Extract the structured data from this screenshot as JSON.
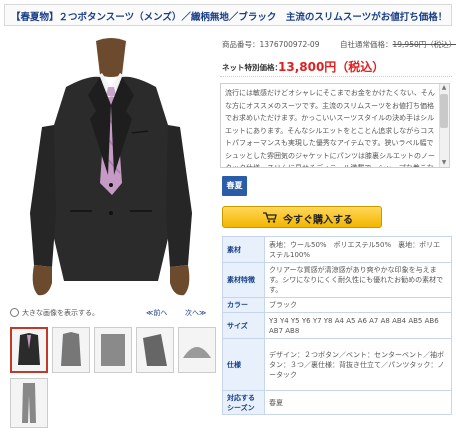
{
  "title": "【春夏物】２つボタンスーツ（メンズ）／織柄無地／ブラック　主流のスリムスーツがお値打ち価格！",
  "product": {
    "code_label": "商品番号：",
    "code": "1376700972-09",
    "list_price_label": "自社通常価格：",
    "list_price": "19,950円（税込）",
    "net_label": "ネット特別価格：",
    "net_price": "13,800円（税込）"
  },
  "description": "流行には敏感だけどオシャレにそこまでお金をかけたくない、そんな方にオススメのスーツです。主流のスリムスーツをお値打ち価格でお求めいただけます。かっこいいスーツスタイルの決め手はシルエットにあります。そんなシルエットをとことん追求しながらコストパフォーマンスも実現した優秀なアイテムです。狭いラペル幅でシュッとした雰囲気のジャケットにパンツは膝裏シルエットのノータック仕様。スリムに見せるディテール満載で、シャープな着こなしが楽しめます。",
  "season_badge": "春夏",
  "buy_button": "今すぐ購入する",
  "zoom": {
    "label": "大きな画像を表示する。",
    "prev": "≪前へ",
    "next": "次へ≫"
  },
  "specs": [
    {
      "label": "素材",
      "value": "表地：ウール50%　ポリエステル50%　裏地：ポリエステル100%"
    },
    {
      "label": "素材特徴",
      "value": "クリアーな質感が清涼感があり爽やかな印象を与えます。シワになりにくく耐久性にも優れたお勧めの素材です。"
    },
    {
      "label": "カラー",
      "value": "ブラック"
    },
    {
      "label": "サイズ",
      "value": "Y3 Y4 Y5 Y6 Y7 Y8 A4 A5 A6 A7 A8 AB4 AB5 AB6 AB7 AB8"
    },
    {
      "label": "仕様",
      "value": "デザイン：２つボタン／ベント：センターベント／袖ボタン：３つ／裏仕様：背抜き仕立て／パンツタック：ノータック"
    },
    {
      "label": "対応するシーズン",
      "value": "春夏"
    }
  ],
  "colors": {
    "title": "#1a3f8a",
    "price": "#e01f1f",
    "badge": "#2a5da8",
    "button": "#f3b600",
    "table_header": "#e7f0fb"
  }
}
